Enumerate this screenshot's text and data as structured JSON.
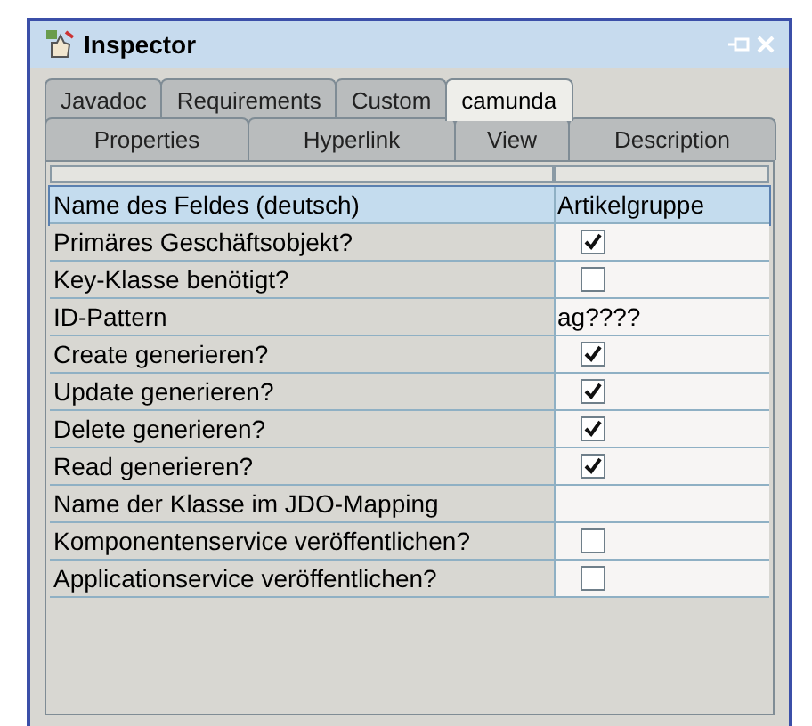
{
  "window": {
    "title": "Inspector"
  },
  "tab_rows": [
    [
      {
        "label": "Javadoc",
        "selected": false
      },
      {
        "label": "Requirements",
        "selected": false
      },
      {
        "label": "Custom",
        "selected": false
      },
      {
        "label": "camunda",
        "selected": true
      }
    ],
    [
      {
        "label": "Properties",
        "selected": false
      },
      {
        "label": "Hyperlink",
        "selected": false
      },
      {
        "label": "View",
        "selected": false
      },
      {
        "label": "Description",
        "selected": false
      }
    ]
  ],
  "properties": [
    {
      "name": "Name des Feldes (deutsch)",
      "kind": "text",
      "value": "Artikelgruppe",
      "selected": true
    },
    {
      "name": "Primäres Geschäftsobjekt?",
      "kind": "check",
      "checked": true,
      "selected": false
    },
    {
      "name": "Key-Klasse benötigt?",
      "kind": "check",
      "checked": false,
      "selected": false
    },
    {
      "name": "ID-Pattern",
      "kind": "text",
      "value": "ag????",
      "selected": false
    },
    {
      "name": "Create generieren?",
      "kind": "check",
      "checked": true,
      "selected": false
    },
    {
      "name": "Update generieren?",
      "kind": "check",
      "checked": true,
      "selected": false
    },
    {
      "name": "Delete generieren?",
      "kind": "check",
      "checked": true,
      "selected": false
    },
    {
      "name": "Read generieren?",
      "kind": "check",
      "checked": true,
      "selected": false
    },
    {
      "name": "Name der Klasse im JDO-Mapping",
      "kind": "empty",
      "selected": false
    },
    {
      "name": "Komponentenservice veröffentlichen?",
      "kind": "check",
      "checked": false,
      "selected": false
    },
    {
      "name": "Applicationservice veröffentlichen?",
      "kind": "check",
      "checked": false,
      "selected": false
    }
  ]
}
